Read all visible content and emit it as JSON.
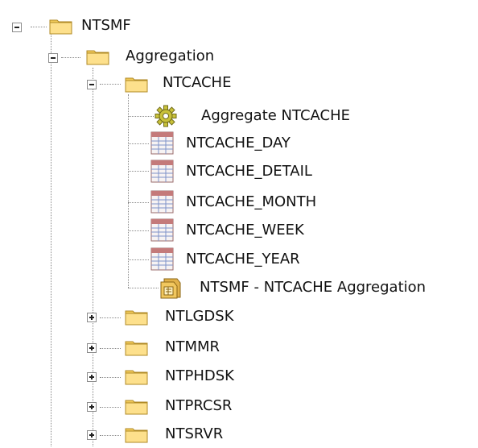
{
  "tree": {
    "nodes": [
      {
        "label": "NTSMF",
        "icon": "folder-icon",
        "expander": "minus"
      },
      {
        "label": "Aggregation",
        "icon": "folder-icon",
        "expander": "minus"
      },
      {
        "label": "NTCACHE",
        "icon": "folder-icon",
        "expander": "minus"
      },
      {
        "label": "Aggregate NTCACHE",
        "icon": "gear-icon",
        "expander": "none"
      },
      {
        "label": "NTCACHE_DAY",
        "icon": "table-icon",
        "expander": "none"
      },
      {
        "label": "NTCACHE_DETAIL",
        "icon": "table-icon",
        "expander": "none"
      },
      {
        "label": "NTCACHE_MONTH",
        "icon": "table-icon",
        "expander": "none"
      },
      {
        "label": "NTCACHE_WEEK",
        "icon": "table-icon",
        "expander": "none"
      },
      {
        "label": "NTCACHE_YEAR",
        "icon": "table-icon",
        "expander": "none"
      },
      {
        "label": "NTSMF - NTCACHE Aggregation",
        "icon": "aggregation-package-icon",
        "expander": "none"
      },
      {
        "label": "NTLGDSK",
        "icon": "folder-icon",
        "expander": "plus"
      },
      {
        "label": "NTMMR",
        "icon": "folder-icon",
        "expander": "plus"
      },
      {
        "label": "NTPHDSK",
        "icon": "folder-icon",
        "expander": "plus"
      },
      {
        "label": "NTPRCSR",
        "icon": "folder-icon",
        "expander": "plus"
      },
      {
        "label": "NTSRVR",
        "icon": "folder-icon",
        "expander": "plus"
      }
    ]
  }
}
